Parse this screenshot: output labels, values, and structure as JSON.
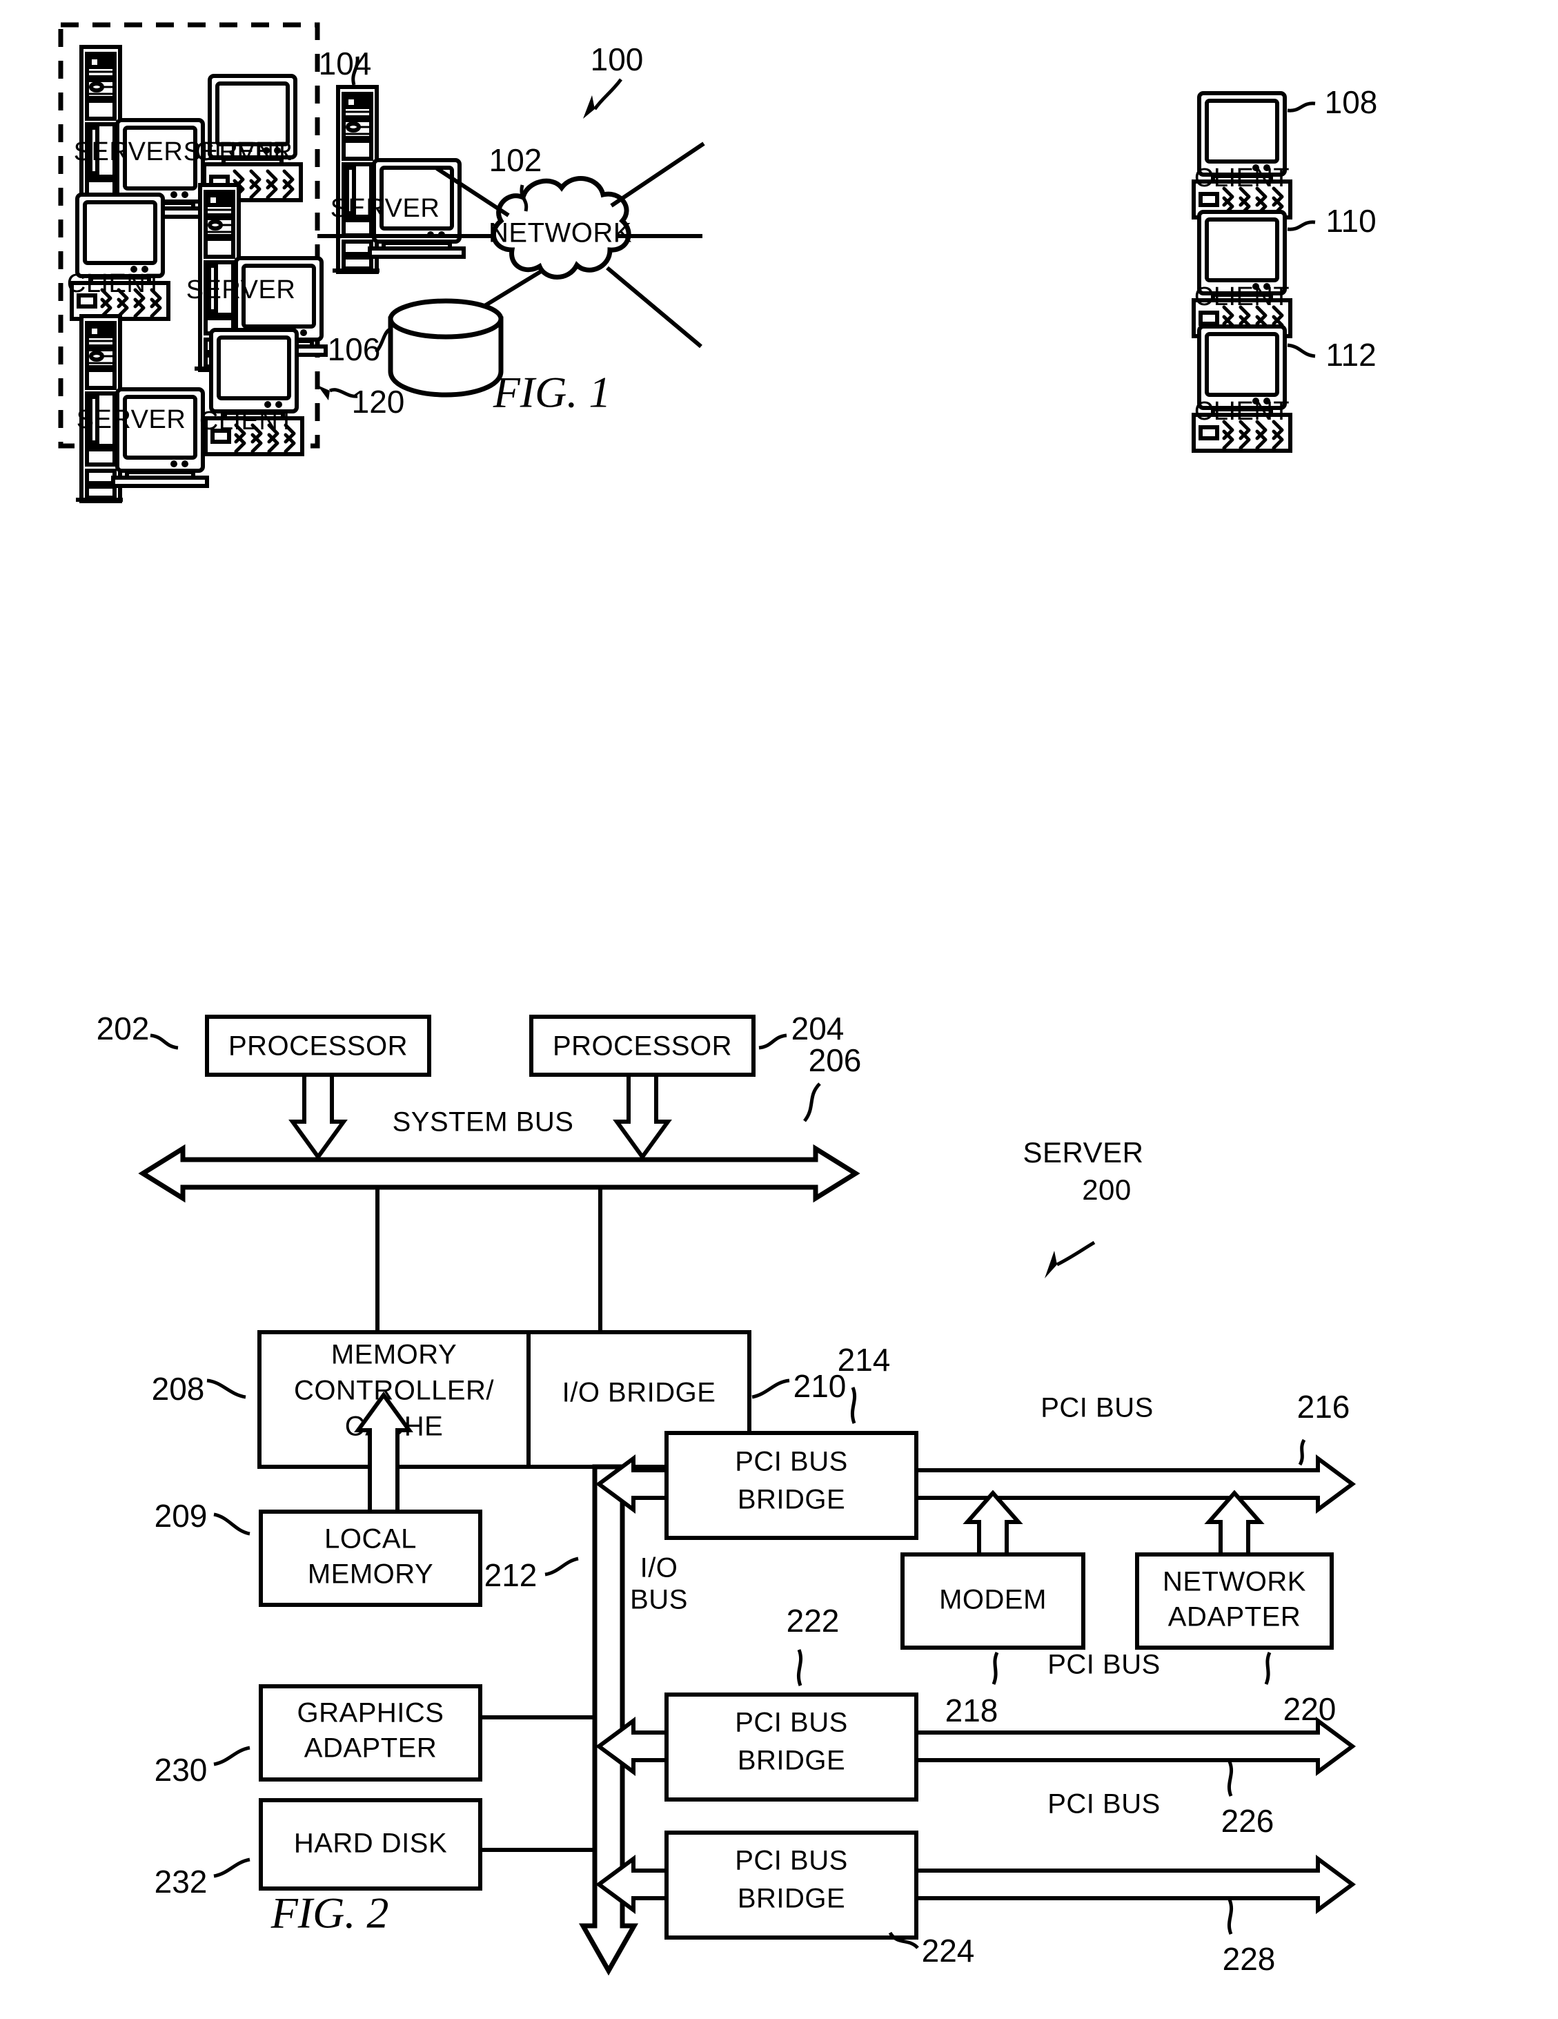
{
  "document": {
    "kind": "patent-drawing-sheet",
    "figures": [
      "FIG. 1",
      "FIG. 2"
    ]
  },
  "fig1": {
    "caption": "FIG. 1",
    "system_ref": "100",
    "network": {
      "label": "NETWORK",
      "ref": "102"
    },
    "storage": {
      "ref": "106"
    },
    "group_box_ref": "120",
    "external_server": {
      "label": "SERVER",
      "ref": "104"
    },
    "right_clients": [
      {
        "label": "CLIENT",
        "ref": "108"
      },
      {
        "label": "CLIENT",
        "ref": "110"
      },
      {
        "label": "CLIENT",
        "ref": "112"
      }
    ],
    "group_nodes": [
      {
        "label": "SERVER",
        "type": "server"
      },
      {
        "label": "CLIENT",
        "type": "client"
      },
      {
        "label": "CLIENT",
        "type": "client"
      },
      {
        "label": "SERVER",
        "type": "server"
      },
      {
        "label": "SERVER",
        "type": "server"
      },
      {
        "label": "CLIENT",
        "type": "client"
      }
    ]
  },
  "fig2": {
    "caption": "FIG. 2",
    "system_label_line1": "SERVER",
    "system_label_line2": "200",
    "blocks": {
      "processor_left": {
        "label": "PROCESSOR",
        "ref": "202"
      },
      "processor_right": {
        "label": "PROCESSOR",
        "ref": "204"
      },
      "memory_controller": {
        "line1": "MEMORY",
        "line2": "CONTROLLER/",
        "line3": "CACHE",
        "ref": "208"
      },
      "io_bridge": {
        "label": "I/O BRIDGE",
        "ref": "210"
      },
      "local_memory": {
        "line1": "LOCAL",
        "line2": "MEMORY",
        "ref": "209"
      },
      "graphics_adapter": {
        "line1": "GRAPHICS",
        "line2": "ADAPTER",
        "ref": "230"
      },
      "hard_disk": {
        "label": "HARD DISK",
        "ref": "232"
      },
      "pci_bridge_1": {
        "line1": "PCI BUS",
        "line2": "BRIDGE",
        "ref": "214"
      },
      "pci_bridge_2": {
        "line1": "PCI BUS",
        "line2": "BRIDGE",
        "ref": "222"
      },
      "pci_bridge_3": {
        "line1": "PCI BUS",
        "line2": "BRIDGE",
        "ref": "224"
      },
      "modem": {
        "label": "MODEM",
        "ref": "218"
      },
      "network_adapter": {
        "line1": "NETWORK",
        "line2": "ADAPTER",
        "ref": "220"
      }
    },
    "buses": {
      "system_bus": {
        "label": "SYSTEM BUS",
        "ref": "206"
      },
      "io_bus": {
        "line1": "I/O",
        "line2": "BUS",
        "ref": "212"
      },
      "pci_bus_1": {
        "label": "PCI BUS",
        "ref": "216"
      },
      "pci_bus_2": {
        "label": "PCI BUS",
        "ref": "226"
      },
      "pci_bus_3": {
        "label": "PCI BUS",
        "ref": "228"
      }
    }
  },
  "colors": {
    "ink": "#000000",
    "paper": "#ffffff"
  }
}
